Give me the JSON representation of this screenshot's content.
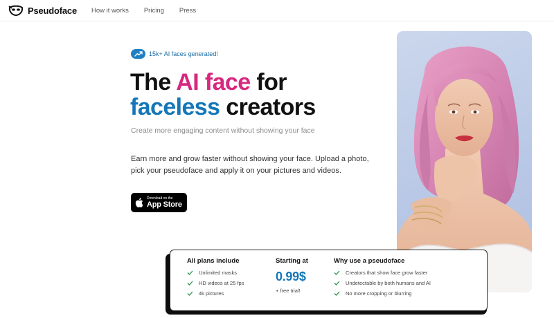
{
  "nav": {
    "brand": "Pseudoface",
    "links": [
      "How it works",
      "Pricing",
      "Press"
    ]
  },
  "hero": {
    "badge": "15k+ AI faces generated!",
    "headline": {
      "part1": "The ",
      "part2": "AI face",
      "part3": " for",
      "part4": "faceless",
      "part5": " creators"
    },
    "subtitle": "Create more engaging content without showing your face",
    "description": "Earn more and grow faster without showing your face. Upload a photo, pick your pseudoface and apply it on your pictures and videos.",
    "appstore": {
      "small": "Download on the",
      "big": "App Store"
    }
  },
  "plans": {
    "col1": {
      "title": "All plans include",
      "items": [
        "Unlimited masks",
        "HD videos at 25 fps",
        "4k pictures"
      ]
    },
    "col2": {
      "title": "Starting at",
      "price": "0.99$",
      "note": "+ free trial!"
    },
    "col3": {
      "title": "Why use a pseudoface",
      "items": [
        "Creators that show face grow faster",
        "Undetectable by both humans and AI",
        "No more cropping or blurring"
      ]
    }
  },
  "colors": {
    "accent_pink": "#d6287d",
    "accent_blue": "#1577b8",
    "check_green": "#2f8f4e"
  }
}
